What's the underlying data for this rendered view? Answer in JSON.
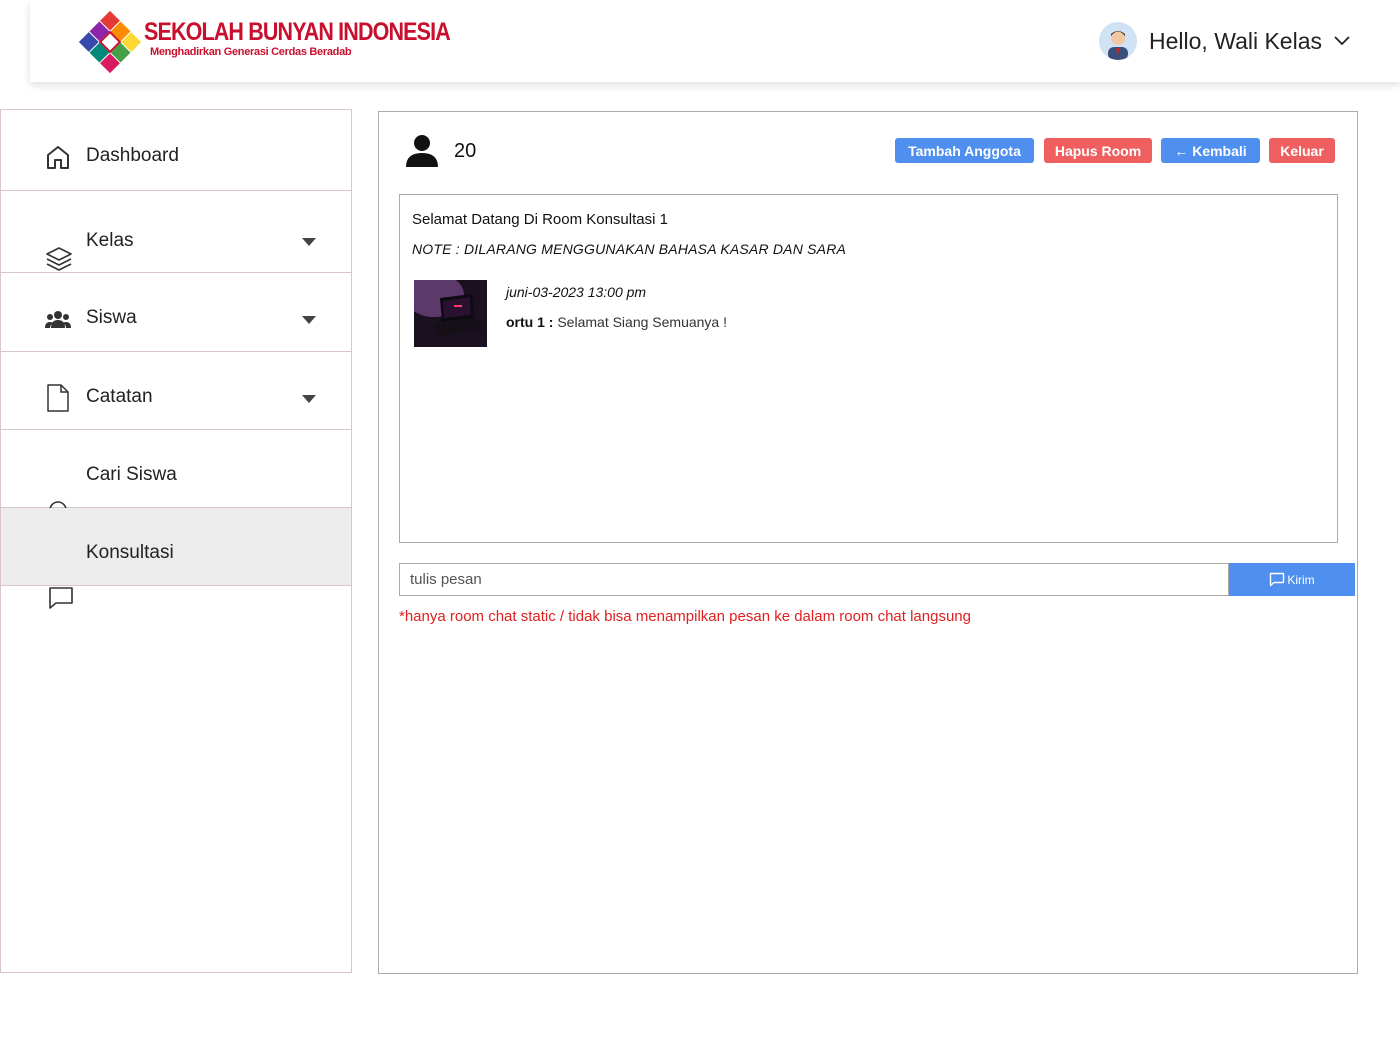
{
  "header": {
    "brand_title": "SEKOLAH BUNYAN INDONESIA",
    "brand_tagline": "Menghadirkan Generasi Cerdas Beradab",
    "greeting": "Hello, Wali Kelas"
  },
  "sidebar": {
    "items": [
      {
        "label": "Dashboard",
        "icon": "home-icon"
      },
      {
        "label": "Kelas",
        "icon": "layers-icon",
        "has_dropdown": true
      },
      {
        "label": "Siswa",
        "icon": "users-icon",
        "has_dropdown": true
      },
      {
        "label": "Catatan",
        "icon": "document-icon",
        "has_dropdown": true
      },
      {
        "label": "Cari Siswa",
        "icon": "search-icon"
      },
      {
        "label": "Konsultasi",
        "icon": "chat-icon",
        "active": true
      }
    ]
  },
  "room": {
    "member_count": "20",
    "buttons": {
      "add_member": "Tambah Anggota",
      "delete_room": "Hapus Room",
      "back": "← Kembali",
      "leave": "Keluar"
    },
    "welcome": "Selamat Datang  Di Room Konsultasi 1",
    "note": "NOTE : DILARANG MENGGUNAKAN BAHASA KASAR DAN SARA",
    "messages": [
      {
        "time": "juni-03-2023 13:00 pm",
        "sender": "ortu 1 :",
        "text": "Selamat Siang Semuanya !"
      }
    ],
    "input_placeholder": "tulis pesan",
    "send_label": "Kirim",
    "warning": "*hanya room chat static / tidak bisa menampilkan pesan ke dalam room chat langsung"
  },
  "colors": {
    "primary": "#4f8ff0",
    "danger": "#ef5f5f",
    "brand_red": "#c8102e",
    "warning_text": "#e02020"
  }
}
